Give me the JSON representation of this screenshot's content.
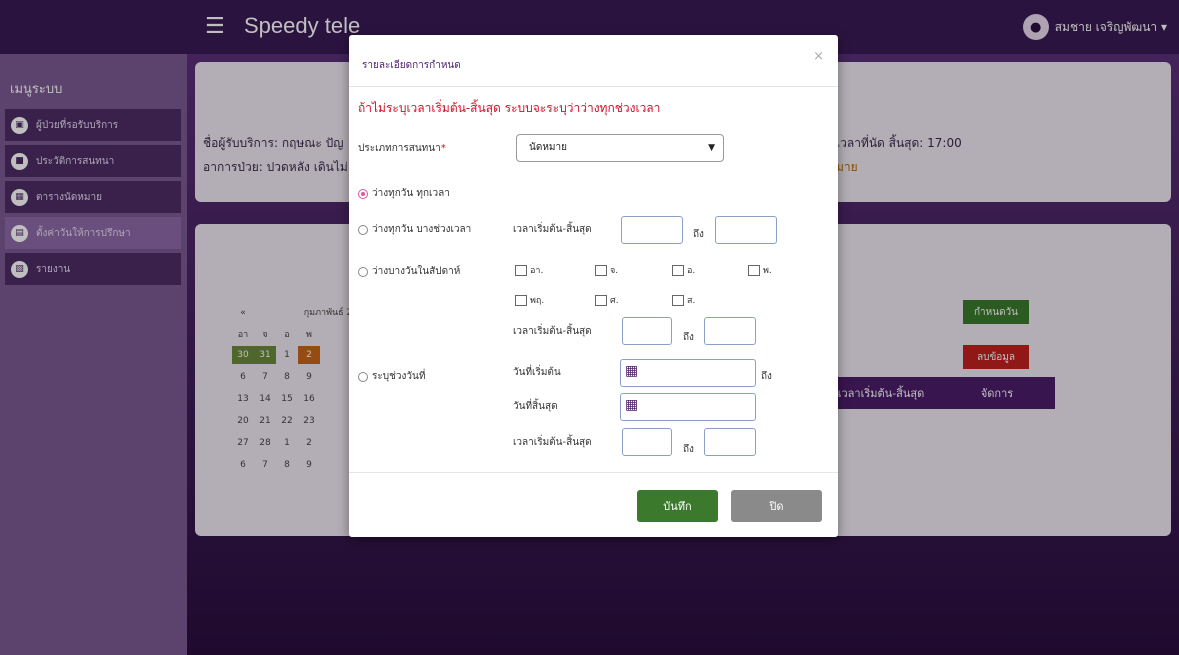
{
  "app": {
    "brand": "Speedy tele",
    "menu_icon": "hamburger-icon"
  },
  "user": {
    "name": "สมชาย เจริญพัฒนา ▾"
  },
  "sidebar": {
    "title": "เมนูระบบ",
    "items": [
      {
        "label": "ผู้ป่วยที่รอรับบริการ",
        "icon": "id-card-icon"
      },
      {
        "label": "ประวัติการสนทนา",
        "icon": "video-icon"
      },
      {
        "label": "ตารางนัดหมาย",
        "icon": "table-icon"
      },
      {
        "label": "ตั้งค่าวันให้การปรึกษา",
        "icon": "calendar-icon"
      },
      {
        "label": "รายงาน",
        "icon": "document-icon"
      }
    ]
  },
  "info_card": {
    "provider": "ชื่อผู้รับบริการ: กฤษณะ ปัญ",
    "symptom": "อาการป่วย: ปวดหลัง เดินไม่",
    "end_time": "เวลาที่นัด สิ้นสุด: 17:00",
    "status": "มาย"
  },
  "calendar": {
    "prev": "«",
    "month": "กุมภาพันธ์ 2",
    "weekdays": [
      "อา",
      "จ",
      "อ",
      "พ"
    ],
    "weeks": [
      [
        "30",
        "31",
        "1",
        "2"
      ],
      [
        "6",
        "7",
        "8",
        "9"
      ],
      [
        "13",
        "14",
        "15",
        "16"
      ],
      [
        "20",
        "21",
        "22",
        "23"
      ],
      [
        "27",
        "28",
        "1",
        "2"
      ],
      [
        "6",
        "7",
        "8",
        "9"
      ]
    ]
  },
  "bg_buttons": {
    "set_day": "กำหนดวัน",
    "delete": "ลบข้อมูล"
  },
  "table": {
    "headers": [
      "เวลาเริ่มต้น-สิ้นสุด",
      "จัดการ"
    ]
  },
  "modal": {
    "title": "รายละเอียดการกำหนด",
    "close": "×",
    "warning": "ถ้าไม่ระบุเวลาเริ่มต้น-สิ้นสุด ระบบจะระบุว่าว่างทุกช่วงเวลา",
    "consult_type_label": "ประเภทการสนทนา",
    "required_mark": "*",
    "consult_type_value": "นัดหมาย",
    "options": {
      "all_day": "ว่างทุกวัน ทุกเวลา",
      "some_time": "ว่างทุกวัน บางช่วงเวลา",
      "some_days": "ว่างบางวันในสัปดาห์",
      "date_range": "ระบุช่วงวันที่"
    },
    "time_range_label": "เวลาเริ่มต้น-สิ้นสุด",
    "to": "ถึง",
    "days": [
      "อา.",
      "จ.",
      "อ.",
      "พ.",
      "พฤ.",
      "ศ.",
      "ส."
    ],
    "start_date_label": "วันที่เริ่มต้น",
    "end_date_label": "วันที่สิ้นสุด",
    "save": "บันทึก",
    "close_btn": "ปิด"
  }
}
